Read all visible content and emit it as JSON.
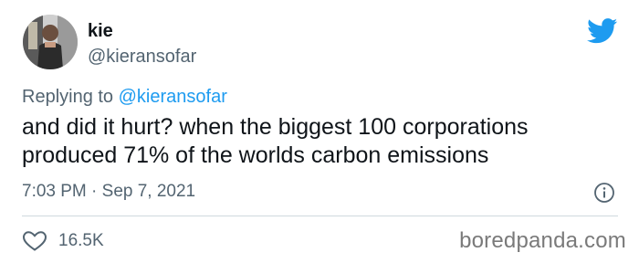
{
  "author": {
    "display_name": "kie",
    "handle": "@kieransofar"
  },
  "reply": {
    "prefix": "Replying to",
    "mention": "@kieransofar"
  },
  "tweet": {
    "text": "and did it hurt? when the biggest 100 corporations produced 71% of the worlds carbon emissions",
    "timestamp": "7:03 PM · Sep 7, 2021"
  },
  "engagement": {
    "likes": "16.5K"
  },
  "watermark": "boredpanda.com",
  "icons": {
    "brand": "twitter-bird-icon",
    "info": "info-icon",
    "like": "heart-icon"
  },
  "colors": {
    "brand_blue": "#1d9bf0",
    "secondary_text": "#536471",
    "primary_text": "#0f1419",
    "divider": "#cfd9de"
  }
}
